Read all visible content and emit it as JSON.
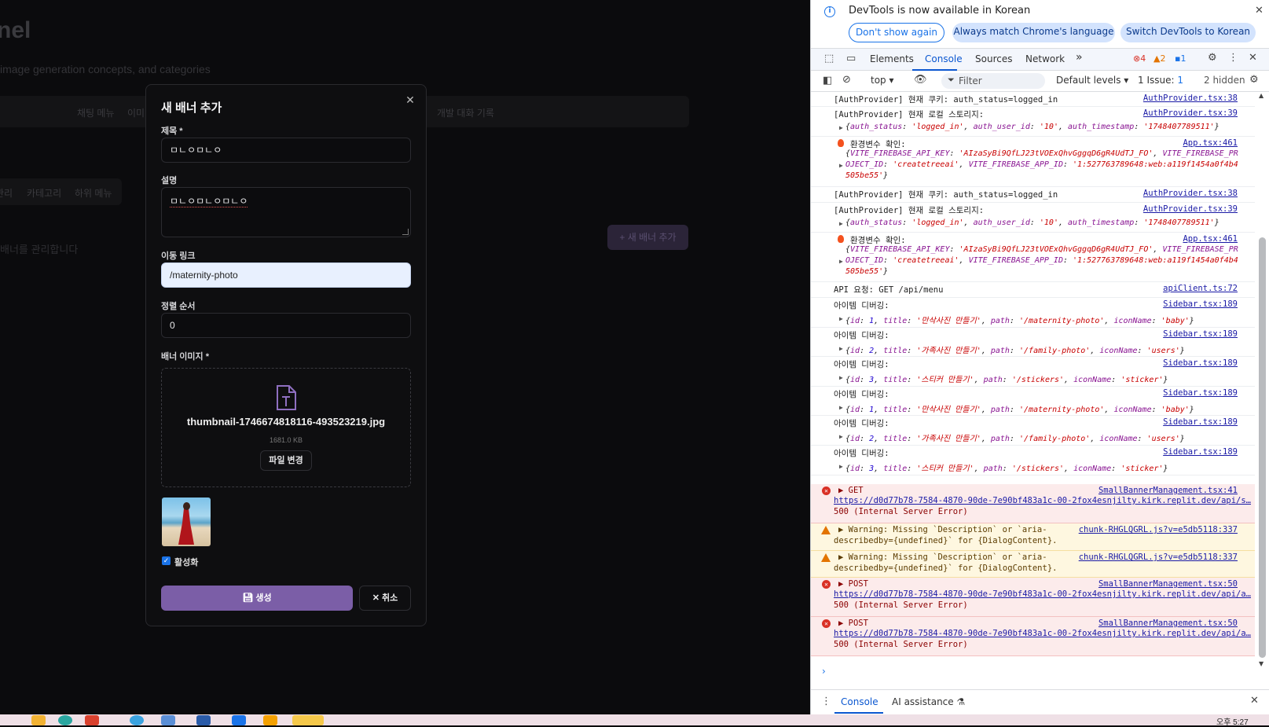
{
  "background_page": {
    "title": "nel",
    "subtitle": "image generation concepts, and categories",
    "tabs_row1": [
      "채팅 메뉴",
      "이미",
      "개발 대화 기록"
    ],
    "tabs_row2": [
      "관리",
      "카테고리",
      "하위 메뉴"
    ],
    "description": "배너를 관리합니다",
    "add_banner_button": "+ 새 배너 추가"
  },
  "dialog": {
    "title": "새 배너 추가",
    "close_icon": "close-icon",
    "title_label": "제목 *",
    "title_value": "ㅁㄴㅇㅁㄴㅇ",
    "description_label": "설명",
    "description_value": "ㅁㄴㅇㅁㄴㅇㅁㄴㅇ",
    "link_label": "이동 링크",
    "link_value": "/maternity-photo",
    "order_label": "정렬 순서",
    "order_value": "0",
    "image_label": "배너 이미지 *",
    "file_name": "thumbnail-1746674818116-493523219.jpg",
    "file_size": "1681.0 KB",
    "change_file_button": "파일 변경",
    "active_label": "활성화",
    "active_checked": true,
    "create_button": "생성",
    "cancel_button": "취소",
    "accent_color": "#7b5ea7"
  },
  "devtools": {
    "banner_text": "DevTools is now available in Korean",
    "btn_dont_show": "Don't show again",
    "btn_always_match": "Always match Chrome's language",
    "btn_switch": "Switch DevTools to Korean",
    "tabs": [
      "Elements",
      "Console",
      "Sources",
      "Network"
    ],
    "more_tabs": "»",
    "error_count": "4",
    "warning_count": "2",
    "info_count": "1",
    "context": "top",
    "filter_placeholder": "Filter",
    "levels": "Default levels",
    "issues_label": "1 Issue:",
    "issues_count": "1",
    "hidden": "2 hidden",
    "drawer_tabs": [
      "Console",
      "AI assistance"
    ]
  },
  "console": {
    "auth_cookie": "[AuthProvider] 현재 쿠키: auth_status=logged_in",
    "auth_local": "[AuthProvider] 현재 로컬 스토리지:",
    "src_auth38": "AuthProvider.tsx:38",
    "src_auth39": "AuthProvider.tsx:39",
    "auth_obj_k1": "auth_status",
    "auth_obj_v1": "'logged_in'",
    "auth_obj_k2": "auth_user_id",
    "auth_obj_v2": "'10'",
    "auth_obj_k3": "auth_timestamp",
    "auth_obj_v3": "'1748407789511'",
    "env_check": "환경변수 확인:",
    "src_app": "App.tsx:461",
    "env_k1": "VITE_FIREBASE_API_KEY",
    "env_v1": "'AIzaSyBi9QfLJ23tVOExQhvGggqD6gR4UdTJ_FO'",
    "env_k1b": "VITE_FIREBASE_PR",
    "env_k2": "OJECT_ID",
    "env_v2": "'createtreeai'",
    "env_k3": "VITE_FIREBASE_APP_ID",
    "env_v3": "'1:527763789648:web:a119f1454a0f4b4",
    "env_v3b": "505be55'",
    "api_request": "API 요청: GET /api/menu",
    "src_api": "apiClient.ts:72",
    "item_debug": "아이템 디버깅:",
    "src_sidebar": "Sidebar.tsx:189",
    "k_id": "id",
    "k_title": "title",
    "k_path": "path",
    "k_icon": "iconName",
    "items": [
      {
        "id": "1",
        "title": "'만삭사진 만들기'",
        "path": "'/maternity-photo'",
        "icon": "'baby'"
      },
      {
        "id": "2",
        "title": "'가족사진 만들기'",
        "path": "'/family-photo'",
        "icon": "'users'"
      },
      {
        "id": "3",
        "title": "'스티커 만들기'",
        "path": "'/stickers'",
        "icon": "'sticker'"
      }
    ],
    "get_label": "GET",
    "post_label": "POST",
    "src_small41": "SmallBannerManagement.tsx:41",
    "src_small50": "SmallBannerManagement.tsx:50",
    "url_get": "https://d0d77b78-7584-4870-90de-7e90bf483a1c-00-2fox4esnjilty.kirk.replit.dev/api/s…",
    "url_post": "https://d0d77b78-7584-4870-90de-7e90bf483a1c-00-2fox4esnjilty.kirk.replit.dev/api/a…",
    "server_error": "500 (Internal Server Error)",
    "warning_line1": "Warning: Missing `Description` or `aria-",
    "warning_line2": "describedby={undefined}` for {DialogContent}.",
    "src_chunk": "chunk-RHGLQGRL.js?v=e5db5118:337"
  },
  "taskbar": {
    "time": "오후 5:27"
  }
}
